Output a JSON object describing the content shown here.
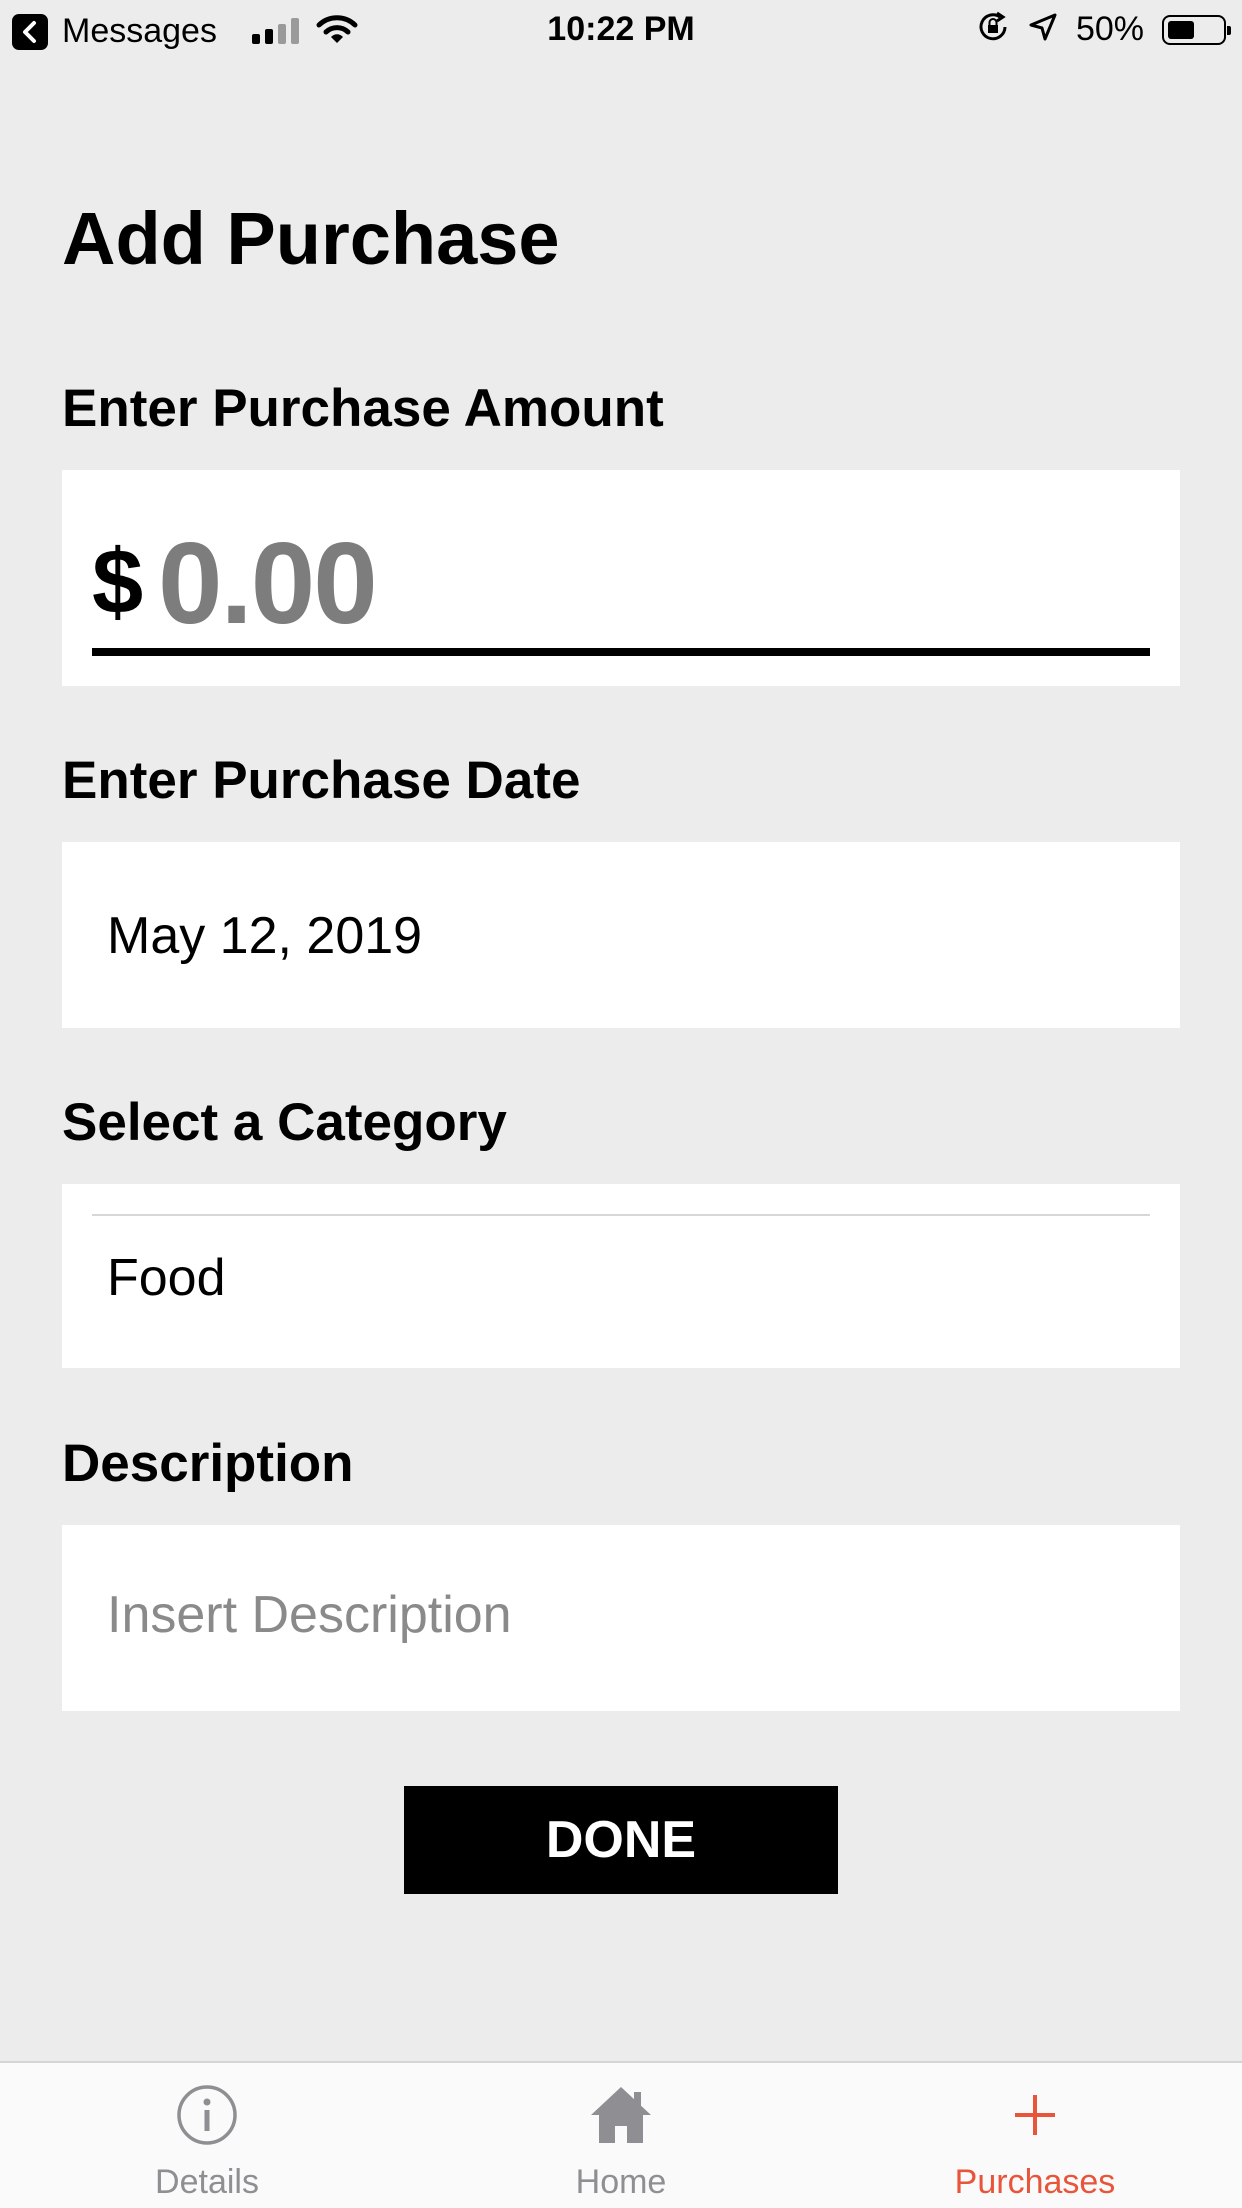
{
  "status_bar": {
    "back_app": "Messages",
    "time": "10:22 PM",
    "battery_percent": "50%",
    "battery_level": 0.5,
    "icons": [
      "back-arrow-icon",
      "cellular-signal-icon",
      "wifi-icon",
      "orientation-lock-icon",
      "location-arrow-icon",
      "battery-icon"
    ]
  },
  "page": {
    "title": "Add Purchase"
  },
  "amount": {
    "label": "Enter Purchase Amount",
    "currency_symbol": "$",
    "value": "0.00"
  },
  "date": {
    "label": "Enter Purchase Date",
    "value": "May 12, 2019"
  },
  "category": {
    "label": "Select a Category",
    "value": "Food"
  },
  "description": {
    "label": "Description",
    "placeholder": "Insert Description",
    "value": ""
  },
  "done_button": {
    "label": "DONE"
  },
  "tab_bar": {
    "active_color": "#e8553a",
    "inactive_color": "#8e8e93",
    "tabs": [
      {
        "label": "Details",
        "icon": "info-circle-icon",
        "active": false
      },
      {
        "label": "Home",
        "icon": "home-icon",
        "active": false
      },
      {
        "label": "Purchases",
        "icon": "plus-icon",
        "active": true
      }
    ]
  }
}
